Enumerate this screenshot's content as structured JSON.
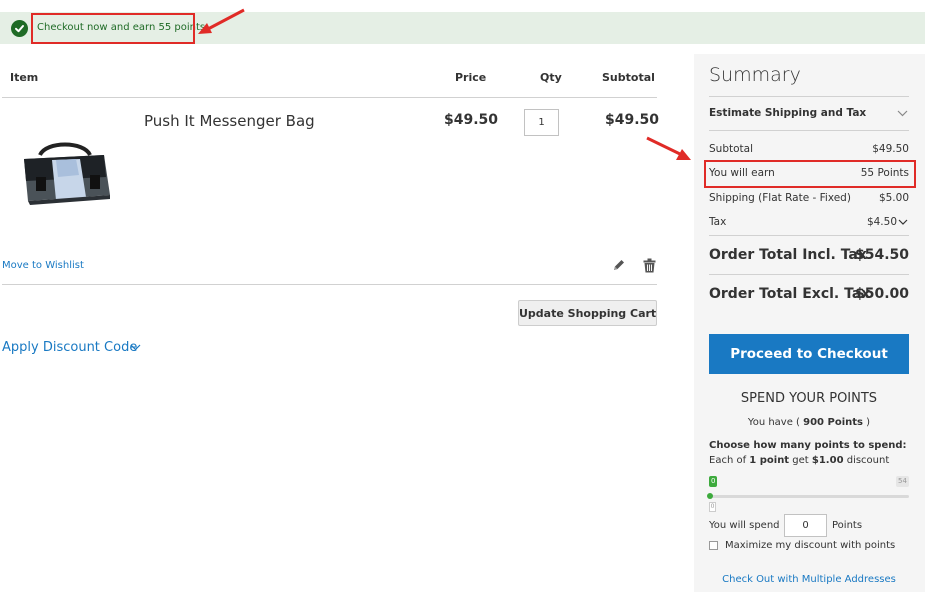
{
  "message": {
    "text": "Checkout now and earn 55 points"
  },
  "cart": {
    "headers": {
      "item": "Item",
      "price": "Price",
      "qty": "Qty",
      "subtotal": "Subtotal"
    },
    "items": [
      {
        "name": "Push It Messenger Bag",
        "price": "$49.50",
        "qty": "1",
        "subtotal": "$49.50"
      }
    ],
    "move_to_wishlist": "Move to Wishlist",
    "update_button": "Update Shopping Cart",
    "discount_label": "Apply Discount Code"
  },
  "summary": {
    "title": "Summary",
    "estimate_label": "Estimate Shipping and Tax",
    "rows": [
      {
        "label": "Subtotal",
        "value": "$49.50"
      },
      {
        "label": "You will earn",
        "value": "55 Points"
      },
      {
        "label": "Shipping (Flat Rate - Fixed)",
        "value": "$5.00"
      },
      {
        "label": "Tax",
        "value": "$4.50"
      }
    ],
    "total_incl_label": "Order Total Incl. Tax",
    "total_incl_value": "$54.50",
    "total_excl_label": "Order Total Excl. Tax",
    "total_excl_value": "$50.00",
    "checkout_button": "Proceed to Checkout"
  },
  "points": {
    "title": "SPEND YOUR POINTS",
    "have_prefix": "You have (",
    "have_value": "900 Points",
    "have_suffix": ")",
    "choose_label": "Choose how many points to spend:",
    "each_prefix": "Each of",
    "each_bold": "1 point",
    "each_mid": "get",
    "each_amount": "$1.00",
    "each_suffix": "discount",
    "slider_min": "0",
    "slider_max": "54",
    "slider_value": 0,
    "spend_prefix": "You will spend",
    "spend_value": "0",
    "spend_suffix": "Points",
    "maximize_label": "Maximize my discount with points",
    "maximize_checked": false,
    "multi_address_link": "Check Out with Multiple Addresses"
  },
  "colors": {
    "accent": "#1979c3",
    "success_bg": "#e5efe5",
    "success_text": "#1f6b26",
    "highlight": "#e02b27"
  }
}
